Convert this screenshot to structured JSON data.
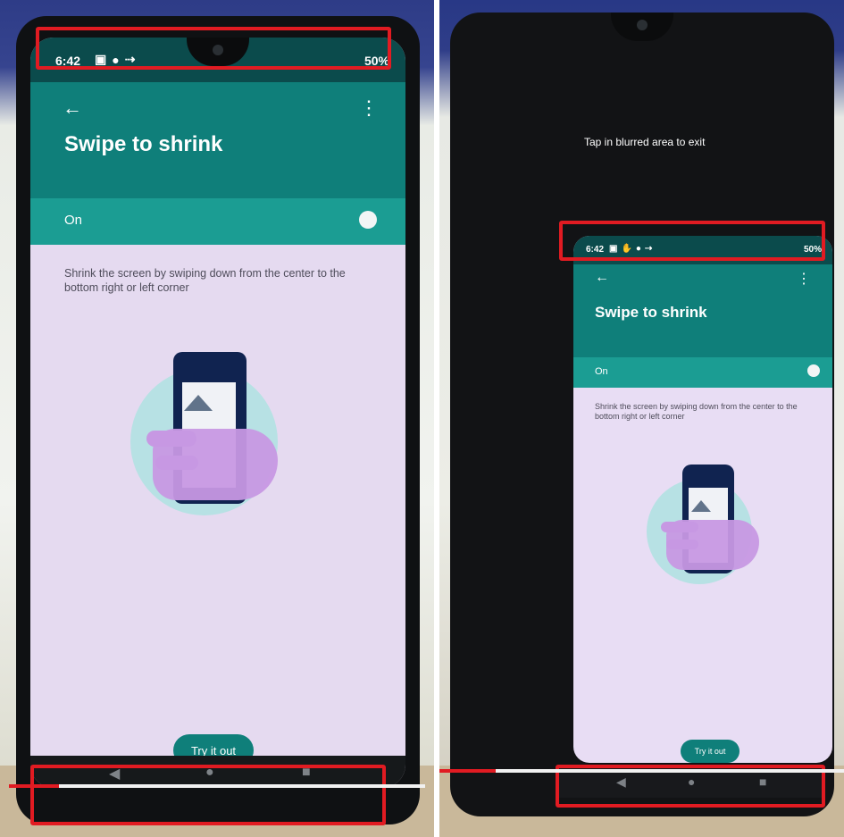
{
  "left": {
    "status": {
      "time": "6:42",
      "battery": "50%"
    },
    "appbar": {
      "back_icon": "back-arrow-icon",
      "more_icon": "more-vert-icon",
      "title": "Swipe to shrink"
    },
    "toggle_row": {
      "label": "On",
      "state": "on"
    },
    "description": "Shrink the screen by swiping down from the center to the bottom right or left corner",
    "button": {
      "label": "Try it out"
    },
    "navigation": {
      "back": "◀",
      "home": "●",
      "recents": "■"
    }
  },
  "right": {
    "hint": "Tap in blurred area to exit",
    "status": {
      "time": "6:42",
      "battery": "50%"
    },
    "appbar": {
      "back_icon": "back-arrow-icon",
      "more_icon": "more-vert-icon",
      "title": "Swipe to shrink"
    },
    "toggle_row": {
      "label": "On",
      "state": "on"
    },
    "description": "Shrink the screen by swiping down from the center to the bottom right or left corner",
    "button": {
      "label": "Try it out"
    },
    "navigation": {
      "back": "◀",
      "home": "●",
      "recents": "■"
    }
  },
  "colors": {
    "teal_dark": "#0b4b4c",
    "teal": "#0f7f7a",
    "teal_light": "#1b9d93",
    "highlight": "#e11b22"
  },
  "progress": {
    "left": 0.12,
    "right": 0.14
  }
}
